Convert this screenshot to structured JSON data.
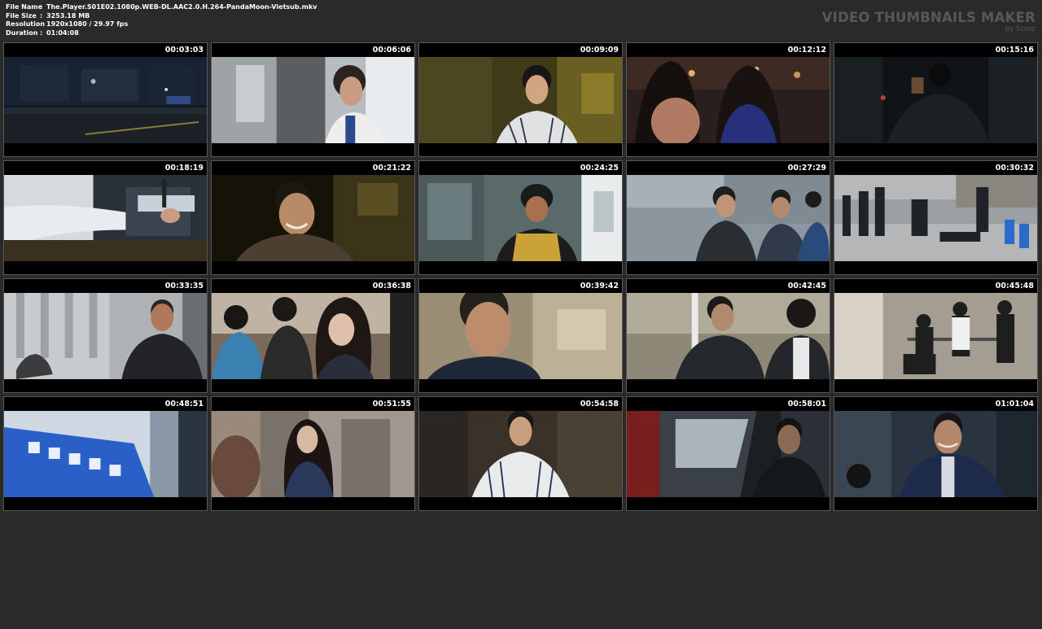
{
  "info": {
    "file_name_label": "File Name",
    "file_name": "The.Player.S01E02.1080p.WEB-DL.AAC2.0.H.264-PandaMoon-Vietsub.mkv",
    "file_size_label": "File Size",
    "file_size": "3253.18 MB",
    "resolution_label": "Resolution",
    "resolution": "1920x1080 / 29.97 fps",
    "duration_label": "Duration",
    "duration": "01:04:08",
    "separator": ":"
  },
  "brand": {
    "title": "VIDEO THUMBNAILS MAKER",
    "subtitle": "by Scorp"
  },
  "thumbnails": [
    {
      "time": "00:03:03",
      "scene": "night-street"
    },
    {
      "time": "00:06:06",
      "scene": "man-elevator"
    },
    {
      "time": "00:09:09",
      "scene": "man-striped-shirt-yellow"
    },
    {
      "time": "00:12:12",
      "scene": "women-bar-night"
    },
    {
      "time": "00:15:16",
      "scene": "dark-room-figure"
    },
    {
      "time": "00:18:19",
      "scene": "hand-lockpick"
    },
    {
      "time": "00:21:22",
      "scene": "man-laughing-car"
    },
    {
      "time": "00:24:25",
      "scene": "courier-helmet"
    },
    {
      "time": "00:27:29",
      "scene": "men-walking-street"
    },
    {
      "time": "00:30:32",
      "scene": "street-fight"
    },
    {
      "time": "00:33:35",
      "scene": "man-suit-street"
    },
    {
      "time": "00:36:38",
      "scene": "woman-crowd"
    },
    {
      "time": "00:39:42",
      "scene": "man-closeup-blur"
    },
    {
      "time": "00:42:45",
      "scene": "men-suits-walking"
    },
    {
      "time": "00:45:48",
      "scene": "group-garage"
    },
    {
      "time": "00:48:51",
      "scene": "blue-banner"
    },
    {
      "time": "00:51:55",
      "scene": "woman-plaid-building"
    },
    {
      "time": "00:54:58",
      "scene": "man-white-jacket"
    },
    {
      "time": "00:58:01",
      "scene": "man-in-car"
    },
    {
      "time": "01:01:04",
      "scene": "man-smiling-suit"
    }
  ],
  "colors": {
    "background": "#2a2a2a",
    "cell_border": "#585858",
    "brand_text": "#585858"
  }
}
